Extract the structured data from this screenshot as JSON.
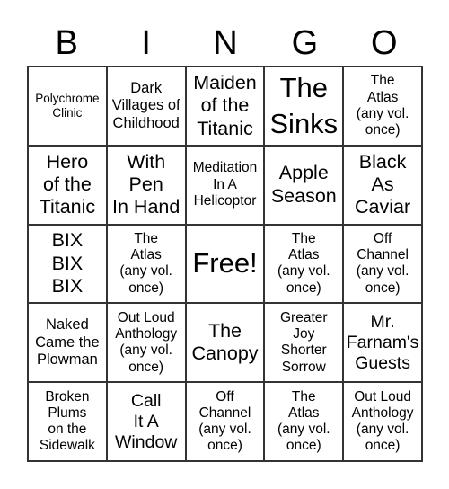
{
  "header": [
    "B",
    "I",
    "N",
    "G",
    "O"
  ],
  "cells": [
    "Polychrome\nClinic",
    "Dark\nVillages of\nChildhood",
    "Maiden\nof the\nTitanic",
    "The\nSinks",
    "The\nAtlas\n(any vol.\nonce)",
    "Hero\nof the\nTitanic",
    "With\nPen\nIn Hand",
    "Meditation\nIn A\nHelicoptor",
    "Apple\nSeason",
    "Black\nAs\nCaviar",
    "BIX\nBIX\nBIX",
    "The\nAtlas\n(any vol.\nonce)",
    "Free!",
    "The\nAtlas\n(any vol.\nonce)",
    "Off\nChannel\n(any vol.\nonce)",
    "Naked\nCame the\nPlowman",
    "Out Loud\nAnthology\n(any vol.\nonce)",
    "The\nCanopy",
    "Greater\nJoy\nShorter\nSorrow",
    "Mr.\nFarnam's\nGuests",
    "Broken\nPlums\non the\nSidewalk",
    "Call\nIt A\nWindow",
    "Off\nChannel\n(any vol.\nonce)",
    "The\nAtlas\n(any vol.\nonce)",
    "Out Loud\nAnthology\n(any vol.\nonce)"
  ]
}
